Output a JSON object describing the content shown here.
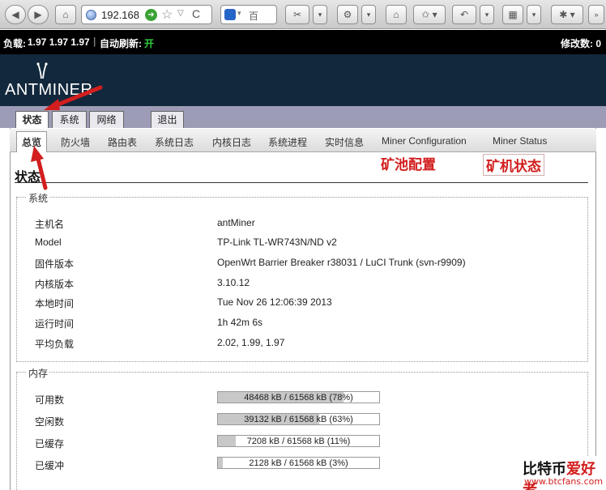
{
  "browser": {
    "url": "192.168",
    "search_text": "百",
    "icons": [
      "back-icon",
      "forward-icon",
      "home-icon",
      "bookmark-icon",
      "reload-icon"
    ]
  },
  "statusbar": {
    "load_label": "负载:",
    "load_value": "1.97 1.97 1.97",
    "refresh_label": "自动刷新:",
    "refresh_value": "开",
    "changes": "修改数: 0"
  },
  "header": {
    "logo_text": "ANTMINER"
  },
  "main_tabs": [
    {
      "label": "状态"
    },
    {
      "label": "系统"
    },
    {
      "label": "网络"
    },
    {
      "label": "退出"
    }
  ],
  "sub_tabs": [
    {
      "label": "总览"
    },
    {
      "label": "防火墙"
    },
    {
      "label": "路由表"
    },
    {
      "label": "系统日志"
    },
    {
      "label": "内核日志"
    },
    {
      "label": "系统进程"
    },
    {
      "label": "实时信息"
    },
    {
      "label": "Miner Configuration"
    },
    {
      "label": "Miner Status"
    }
  ],
  "page": {
    "title": "状态"
  },
  "system": {
    "legend": "系统",
    "rows": [
      {
        "label": "主机名",
        "value": "antMiner"
      },
      {
        "label": "Model",
        "value": "TP-Link TL-WR743N/ND v2"
      },
      {
        "label": "固件版本",
        "value": "OpenWrt Barrier Breaker r38031 / LuCI Trunk (svn-r9909)"
      },
      {
        "label": "内核版本",
        "value": "3.10.12"
      },
      {
        "label": "本地时间",
        "value": "Tue Nov 26 12:06:39 2013"
      },
      {
        "label": "运行时间",
        "value": "1h 42m 6s"
      },
      {
        "label": "平均负载",
        "value": "2.02, 1.99, 1.97"
      }
    ]
  },
  "memory": {
    "legend": "内存",
    "rows": [
      {
        "label": "可用数",
        "text": "48468 kB / 61568 kB (78%)",
        "fraction": 0.78
      },
      {
        "label": "空闲数",
        "text": "39132 kB / 61568 kB (63%)",
        "fraction": 0.63
      },
      {
        "label": "已缓存",
        "text": "7208 kB / 61568 kB (11%)",
        "fraction": 0.11
      },
      {
        "label": "已缓冲",
        "text": "2128 kB / 61568 kB (3%)",
        "fraction": 0.03
      }
    ]
  },
  "annotations": {
    "pool_config": "矿池配置",
    "miner_status": "矿机状态"
  },
  "watermark": {
    "top_a": "比特币",
    "top_b": "爱好者",
    "bottom": "www.btcfans.com"
  },
  "colors": {
    "header_bg": "#12283c",
    "tabstrip_bg": "#9d9cb6",
    "annotation_red": "#d21e1e",
    "refresh_on": "#2ecc40"
  }
}
